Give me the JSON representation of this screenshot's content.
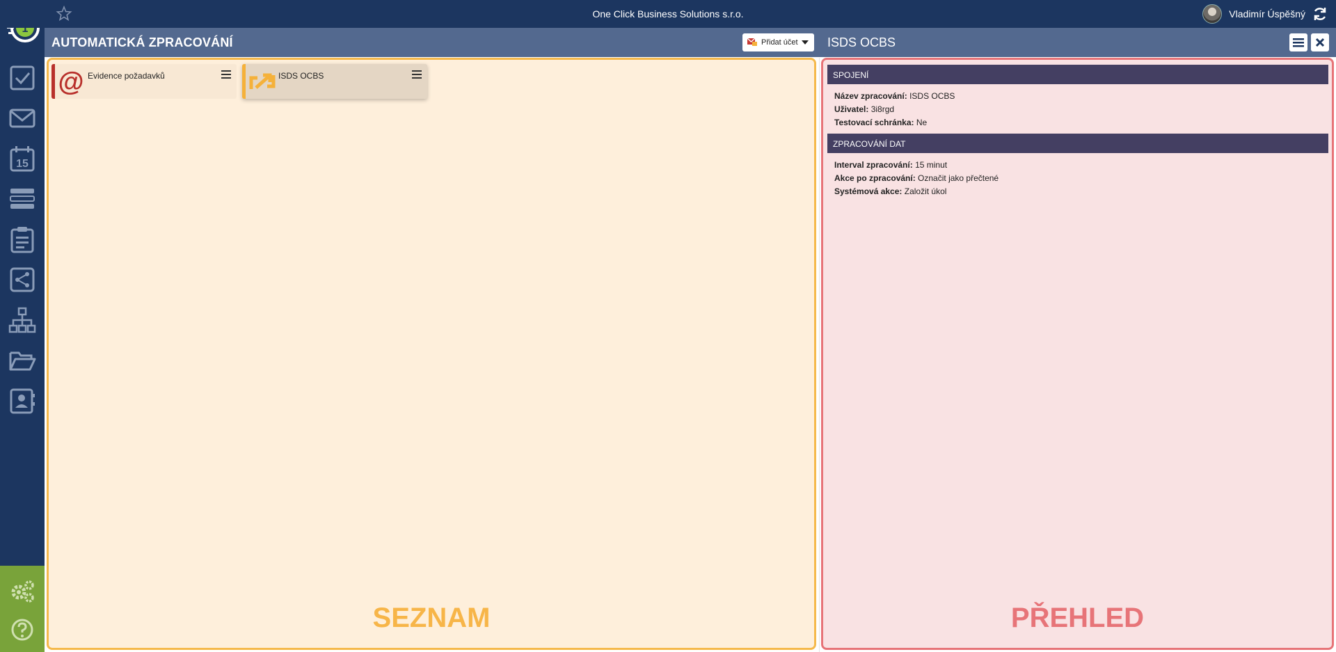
{
  "topbar": {
    "company": "One Click Business Solutions s.r.o.",
    "user_name": "Vladimír Úspěšný",
    "icons": [
      "star-icon",
      "refresh-icon"
    ]
  },
  "sidebar": {
    "logo_number": "1",
    "calendar_day": "15",
    "items": [
      {
        "icon": "tasks-check-icon"
      },
      {
        "icon": "mail-icon"
      },
      {
        "icon": "calendar-icon"
      },
      {
        "icon": "records-list-icon"
      },
      {
        "icon": "clipboard-icon"
      },
      {
        "icon": "workflow-icon"
      },
      {
        "icon": "org-chart-icon"
      },
      {
        "icon": "folder-open-icon"
      },
      {
        "icon": "contacts-icon"
      }
    ],
    "bottom": [
      {
        "icon": "settings-gears-icon"
      },
      {
        "icon": "help-icon"
      }
    ],
    "accent_color": "#79a33a"
  },
  "header": {
    "title": "AUTOMATICKÁ ZPRACOVÁNÍ",
    "add_account_label": "Přidat účet",
    "detail_title": "ISDS OCBS"
  },
  "list": {
    "watermark": "SEZNAM",
    "cards": [
      {
        "name": "Evidence požadavků",
        "icon": "at-sign-icon",
        "bar_color": "#b8302b"
      },
      {
        "name": "ISDS OCBS",
        "icon": "isds-arrow-icon",
        "bar_color": "#f5b13a"
      }
    ]
  },
  "detail": {
    "watermark": "PŘEHLED",
    "sections": [
      {
        "title": "SPOJENÍ",
        "rows": [
          {
            "label": "Název zpracování:",
            "value": "ISDS OCBS"
          },
          {
            "label": "Uživatel:",
            "value": "3i8rgd"
          },
          {
            "label": "Testovací schránka:",
            "value": "Ne"
          }
        ]
      },
      {
        "title": "ZPRACOVÁNÍ DAT",
        "rows": [
          {
            "label": "Interval zpracování:",
            "value": "15 minut"
          },
          {
            "label": "Akce po zpracování:",
            "value": "Označit jako přečtené"
          },
          {
            "label": "Systémová akce:",
            "value": "Založit úkol"
          }
        ]
      }
    ]
  },
  "colors": {
    "navy": "#1c3660",
    "header": "#53698f",
    "list_bg": "#feefdb",
    "list_border": "#f5b94b",
    "detail_bg": "#f9e2e3",
    "detail_border": "#e77478",
    "section_head": "#443f62"
  }
}
